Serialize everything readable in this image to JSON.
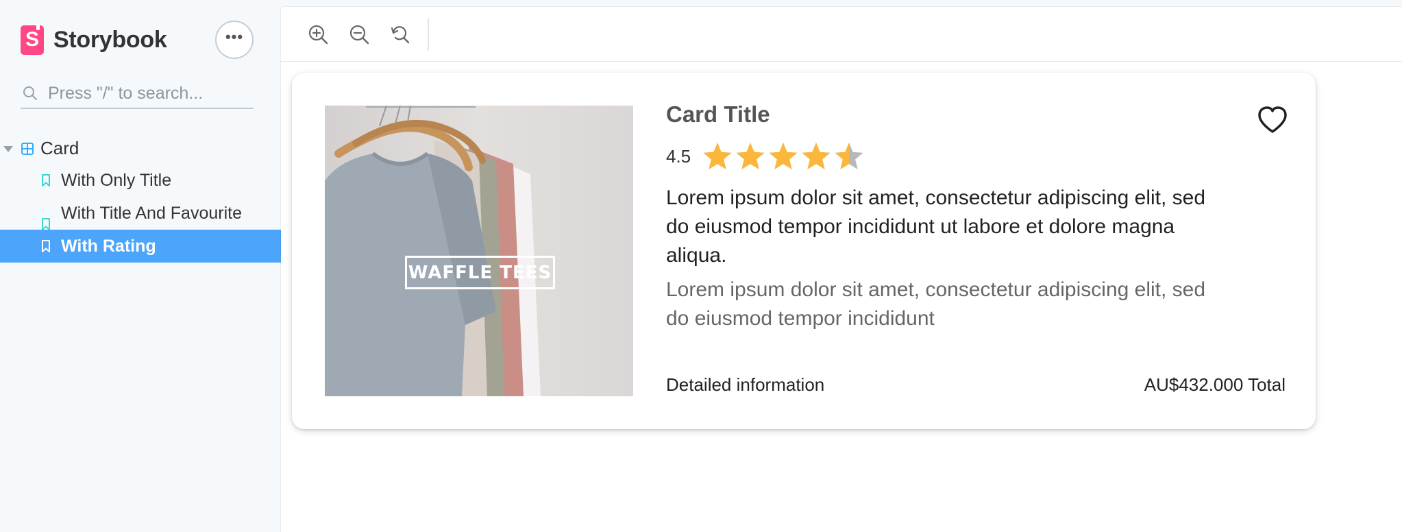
{
  "sidebar": {
    "brand": "Storybook",
    "menu_label": "•••",
    "search_placeholder": "Press \"/\" to search...",
    "group": {
      "label": "Card",
      "expanded": true
    },
    "stories": [
      {
        "label": "With Only Title",
        "selected": false
      },
      {
        "label": "With Title And Favourite",
        "selected": false
      },
      {
        "label": "With Rating",
        "selected": true
      }
    ]
  },
  "toolbar": {
    "buttons": [
      "zoom-in-icon",
      "zoom-out-icon",
      "reset-zoom-icon"
    ]
  },
  "card": {
    "image_text": "WAFFLE TEES",
    "title": "Card Title",
    "rating": "4.5",
    "rating_max": 5,
    "description_primary": "Lorem ipsum dolor sit amet, consectetur adipiscing elit, sed do eiusmod tempor incididunt ut labore et dolore magna aliqua.",
    "description_secondary": "Lorem ipsum dolor sit amet, consectetur adipiscing elit, sed do eiusmod tempor incididunt",
    "footer_left": "Detailed information",
    "footer_right": "AU$432.000 Total",
    "favourite_icon": "heart-outline-icon"
  },
  "colors": {
    "accent": "#4ca5fa",
    "brand": "#ff4785",
    "star": "#fbb73b",
    "star_empty": "#b8b8b8"
  }
}
